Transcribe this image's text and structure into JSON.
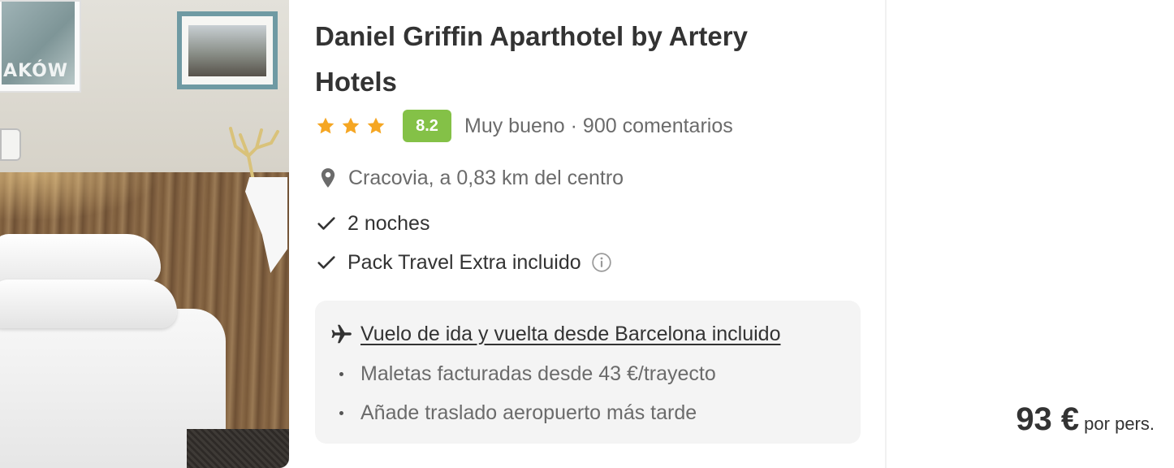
{
  "hotel": {
    "name": "Daniel Griffin Aparthotel by Artery Hotels",
    "stars": 3,
    "score": "8.2",
    "review_summary": "Muy bueno · 900 comentarios",
    "location": "Cracovia, a 0,83 km del centro",
    "photo_sign_text": "AKÓW"
  },
  "features": [
    {
      "label": "2 noches",
      "icon": "check-icon"
    },
    {
      "label": "Pack Travel Extra incluido",
      "icon": "check-icon",
      "info_icon": "info-icon"
    }
  ],
  "flight": {
    "title": "Vuelo de ida y vuelta desde Barcelona incluido",
    "icon": "plane-icon",
    "bullets": [
      "Maletas facturadas desde 43 €/trayecto",
      "Añade traslado aeropuerto más tarde"
    ]
  },
  "price": {
    "amount": "93 €",
    "per": "por pers."
  },
  "colors": {
    "score_badge": "#84c147",
    "star": "#f5a623",
    "flight_box_bg": "#f4f4f4",
    "muted_text": "#6b6b6b",
    "main_text": "#333333"
  }
}
